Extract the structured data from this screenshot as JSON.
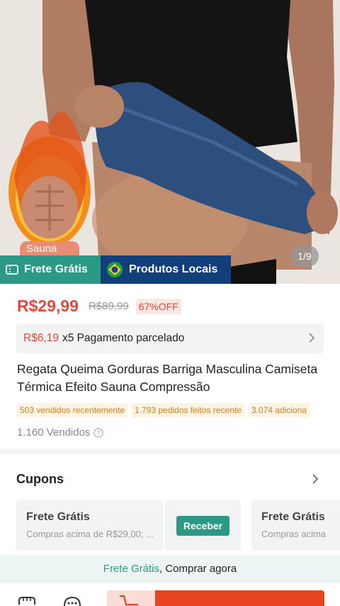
{
  "hero": {
    "pager": "1/9",
    "sauna_tag": "Sauna",
    "badges": [
      {
        "label": "Frete Grátis",
        "icon": "ticket-icon",
        "color": "#2a9a86"
      },
      {
        "label": "Produtos Locais",
        "icon": "brazil-flag-icon",
        "color": "#123f7a"
      }
    ]
  },
  "price": {
    "current": "R$29,99",
    "original": "R$89,99",
    "discount": "67%OFF"
  },
  "installment": {
    "amount": "R$6,19",
    "text": "x5 Pagamento parcelado"
  },
  "product": {
    "title": "Regata Queima Gorduras Barriga Masculina Camiseta Térmica Efeito Sauna Compressão",
    "tags": [
      "503 vendidos recentemente",
      "1.793 pedidos feitos recente",
      "3.074 adiciona"
    ],
    "sold": "1.160 Vendidos"
  },
  "coupons": {
    "title": "Cupons",
    "items": [
      {
        "title": "Frete Grátis",
        "desc": "Compras acima de R$29,00; ...",
        "button": "Receber"
      },
      {
        "title": "Frete Grátis",
        "desc": "Compras acima"
      }
    ]
  },
  "banner": {
    "highlight": "Frete Grátis",
    "text": ", Comprar agora"
  },
  "colors": {
    "accent_red": "#e2493a",
    "teal": "#2a9a86",
    "navy": "#123f7a",
    "buy_orange": "#e8441f"
  }
}
